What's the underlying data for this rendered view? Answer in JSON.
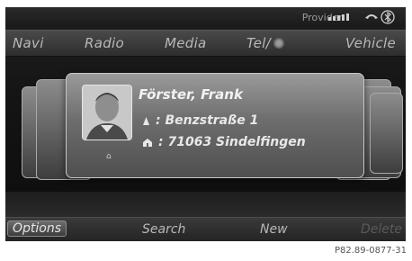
{
  "status": {
    "provider_label": "Provider",
    "icons": [
      "signal-strength-icon",
      "handset-icon",
      "bluetooth-icon"
    ]
  },
  "menu": {
    "items": [
      "Navi",
      "Radio",
      "Media",
      "Tel/",
      "Vehicle"
    ]
  },
  "contact": {
    "name": "Förster, Frank",
    "street_line": ": Benzstraße 1",
    "city_line": ": 71063 Sindelfingen"
  },
  "bottom_bar": {
    "items": [
      "Options",
      "Search",
      "New",
      "Delete"
    ],
    "active": "Options",
    "disabled": "Delete"
  },
  "caption": "P82.89-0877-31"
}
